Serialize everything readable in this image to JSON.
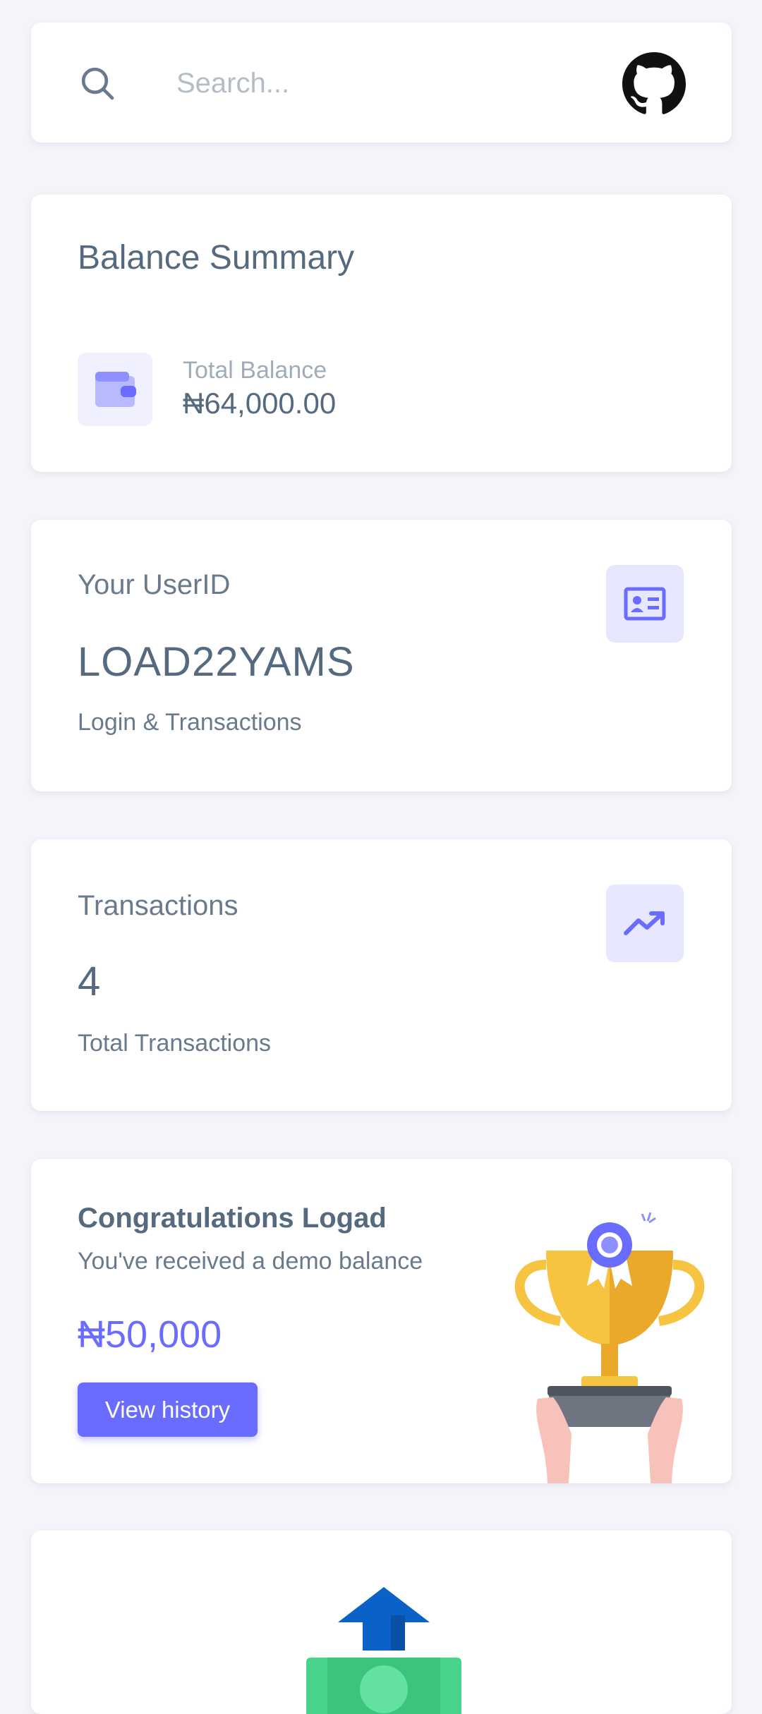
{
  "search": {
    "placeholder": "Search..."
  },
  "balance_summary": {
    "title": "Balance Summary",
    "total_label": "Total Balance",
    "total_value": "₦64,000.00"
  },
  "user_id_card": {
    "label": "Your UserID",
    "value": "LOAD22YAMS",
    "subtitle": "Login & Transactions"
  },
  "transactions_card": {
    "label": "Transactions",
    "value": "4",
    "subtitle": "Total Transactions"
  },
  "congrats_card": {
    "title": "Congratulations Logad",
    "subtitle": "You've received a demo balance",
    "amount": "₦50,000",
    "button_label": "View history"
  },
  "colors": {
    "accent": "#696cff",
    "accent_light": "#e7e7ff",
    "text": "#566a7f",
    "background": "#f4f5fa"
  },
  "icons": [
    "search-icon",
    "github-icon",
    "wallet-icon",
    "id-card-icon",
    "trending-up-icon",
    "trophy-icon",
    "money-upload-icon"
  ]
}
